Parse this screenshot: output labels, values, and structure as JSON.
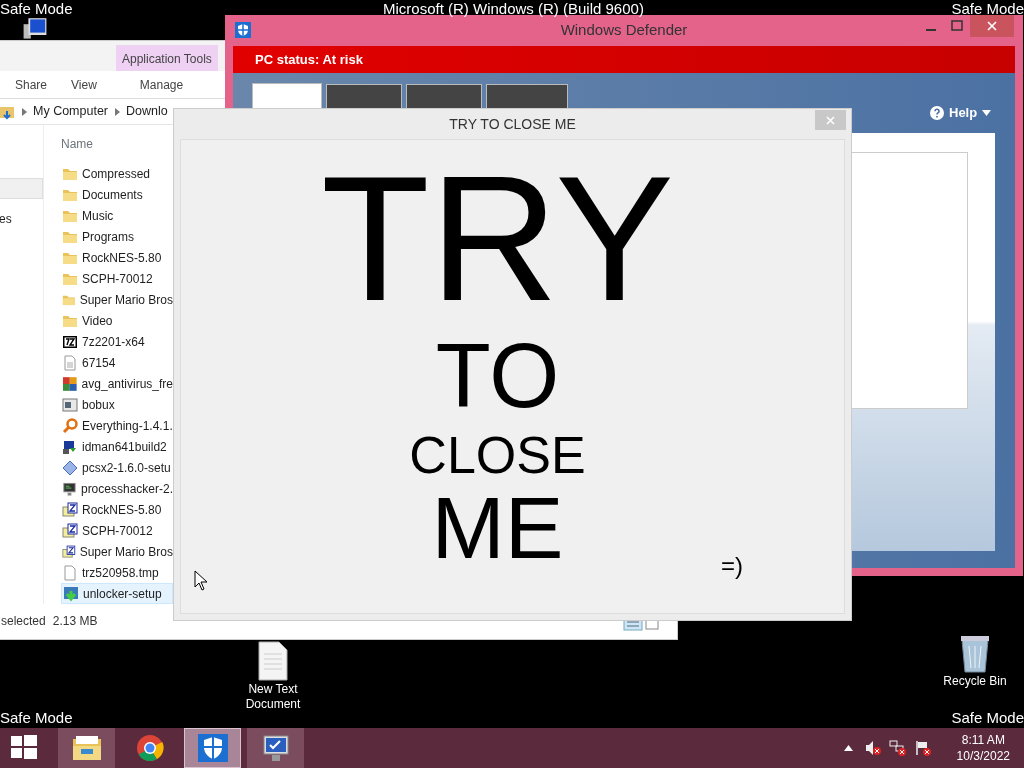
{
  "desktop": {
    "watermarks": [
      {
        "text": "Safe Mode",
        "kind": "top-left"
      },
      {
        "text": "Microsoft (R) Windows (R) (Build 9600)",
        "kind": "top-center"
      },
      {
        "text": "Safe Mode",
        "kind": "top-right"
      },
      {
        "text": "Safe Mode",
        "kind": "bottom-left"
      },
      {
        "text": "Safe Mode",
        "kind": "bottom-right"
      }
    ],
    "icons": [
      {
        "label": "New Text Document",
        "kind": "text-file"
      },
      {
        "label": "Recycle Bin",
        "kind": "recycle-bin"
      }
    ]
  },
  "explorer": {
    "context_tab": "Application Tools",
    "ribbon_tabs": [
      {
        "label": "Share",
        "selected": false
      },
      {
        "label": "View",
        "selected": false
      },
      {
        "label": "Manage",
        "selected": false
      }
    ],
    "breadcrumb": [
      "My Computer",
      "Downlo"
    ],
    "nav_items": [
      {
        "selected": true
      },
      {
        "label": "es",
        "selected": false
      }
    ],
    "column_header": "Name",
    "files": [
      {
        "name": "Compressed",
        "kind": "folder",
        "selected": false
      },
      {
        "name": "Documents",
        "kind": "folder",
        "selected": false
      },
      {
        "name": "Music",
        "kind": "folder",
        "selected": false
      },
      {
        "name": "Programs",
        "kind": "folder",
        "selected": false
      },
      {
        "name": "RockNES-5.80",
        "kind": "folder",
        "selected": false
      },
      {
        "name": "SCPH-70012",
        "kind": "folder",
        "selected": false
      },
      {
        "name": "Super Mario Bros",
        "kind": "folder",
        "selected": false
      },
      {
        "name": "Video",
        "kind": "folder",
        "selected": false
      },
      {
        "name": "7z2201-x64",
        "kind": "archiver",
        "selected": false
      },
      {
        "name": "67154",
        "kind": "text",
        "selected": false
      },
      {
        "name": "avg_antivirus_fre",
        "kind": "tiles",
        "selected": false
      },
      {
        "name": "bobux",
        "kind": "window",
        "selected": false
      },
      {
        "name": "Everything-1.4.1.",
        "kind": "magnifier",
        "selected": false
      },
      {
        "name": "idman641build2",
        "kind": "download",
        "selected": false
      },
      {
        "name": "pcsx2-1.6.0-setu",
        "kind": "diamond",
        "selected": false
      },
      {
        "name": "processhacker-2.",
        "kind": "monitor",
        "selected": false
      },
      {
        "name": "RockNES-5.80",
        "kind": "zip",
        "selected": false
      },
      {
        "name": "SCPH-70012",
        "kind": "zip",
        "selected": false
      },
      {
        "name": "Super Mario Bros",
        "kind": "zip",
        "selected": false
      },
      {
        "name": "trz520958.tmp",
        "kind": "blank",
        "selected": false
      },
      {
        "name": "unlocker-setup",
        "kind": "installer",
        "selected": true
      }
    ],
    "status": [
      "selected",
      "2.13 MB"
    ]
  },
  "defender": {
    "title": "Windows Defender",
    "status": "PC status: At risk",
    "help": "Help",
    "tabs": [
      {
        "selected": true
      },
      {
        "selected": false
      },
      {
        "selected": false
      },
      {
        "selected": false
      }
    ]
  },
  "popup": {
    "title": "TRY TO CLOSE ME",
    "lines": [
      "TRY",
      "TO",
      "CLOSE",
      "ME"
    ],
    "smiley": "=)"
  },
  "taskbar": {
    "apps": [
      {
        "kind": "start",
        "running": false,
        "selected": false
      },
      {
        "kind": "explorer",
        "running": true,
        "selected": false
      },
      {
        "kind": "chrome",
        "running": false,
        "selected": false
      },
      {
        "kind": "defender",
        "running": true,
        "selected": true
      },
      {
        "kind": "monitor",
        "running": true,
        "selected": false
      }
    ],
    "tray": [
      {
        "kind": "chevron"
      },
      {
        "kind": "speaker-muted"
      },
      {
        "kind": "network-error"
      },
      {
        "kind": "flag-error"
      }
    ],
    "clock": {
      "time": "8:11 AM",
      "date": "10/3/2022"
    }
  }
}
